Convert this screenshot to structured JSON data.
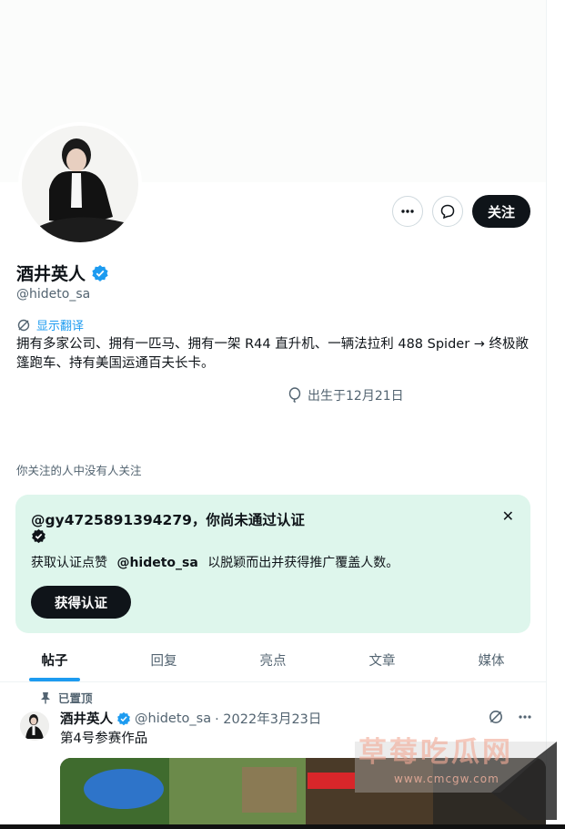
{
  "profile": {
    "name": "酒井英人",
    "handle": "@hideto_sa",
    "translate_label": "显示翻译",
    "bio": "拥有多家公司、拥有一匹马、拥有一架 R44 直升机、一辆法拉利 488 Spider → 终极敞篷跑车、持有美国运通百夫长卡。",
    "birthday": "出生于12月21日",
    "followers_note": "你关注的人中没有人关注",
    "follow_label": "关注"
  },
  "verify_card": {
    "title": "@gy4725891394279，你尚未通过认证",
    "desc_prefix": "获取认证点赞",
    "desc_handle": "@hideto_sa",
    "desc_suffix": "以脱颖而出并获得推广覆盖人数。",
    "button_label": "获得认证",
    "close_glyph": "✕"
  },
  "tabs": [
    {
      "label": "帖子",
      "active": true
    },
    {
      "label": "回复",
      "active": false
    },
    {
      "label": "亮点",
      "active": false
    },
    {
      "label": "文章",
      "active": false
    },
    {
      "label": "媒体",
      "active": false
    }
  ],
  "pinned_post": {
    "pinned_label": "已置顶",
    "author_name": "酒井英人",
    "author_handle": "@hideto_sa",
    "date": "· 2022年3月23日",
    "text": "第4号参赛作品"
  },
  "watermark": {
    "text": "草莓吃瓜网",
    "url": "www.cmcgw.com"
  },
  "colors": {
    "accent": "#1d9bf0",
    "verify_card_bg": "#def6ec",
    "primary_button": "#0f1419"
  }
}
